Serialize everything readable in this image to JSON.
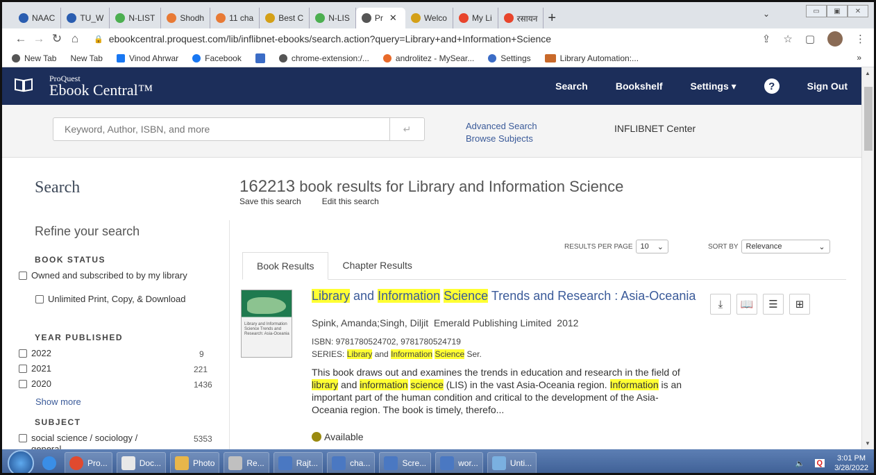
{
  "browser": {
    "tabs": [
      {
        "label": "NAAC",
        "color": "#2a5db0"
      },
      {
        "label": "TU_W",
        "color": "#2a5db0"
      },
      {
        "label": "N-LIST",
        "color": "#4caf50"
      },
      {
        "label": "Shodh",
        "color": "#e87a35"
      },
      {
        "label": "11 cha",
        "color": "#e87a35"
      },
      {
        "label": "Best C",
        "color": "#d4a017"
      },
      {
        "label": "N-LIS",
        "color": "#4caf50"
      },
      {
        "label": "Pr",
        "color": "#555555",
        "active": true
      },
      {
        "label": "Welco",
        "color": "#d4a017"
      },
      {
        "label": "My Li",
        "color": "#e8452c"
      },
      {
        "label": "रसायन",
        "color": "#e8452c"
      }
    ],
    "newtab": "+",
    "url": "ebookcentral.proquest.com/lib/inflibnet-ebooks/search.action?query=Library+and+Information+Science",
    "bookmarks": [
      {
        "label": "New Tab",
        "icon": "globe-icon"
      },
      {
        "label": "New Tab",
        "icon": ""
      },
      {
        "label": "Vinod Ahrwar",
        "icon": "facebook-icon"
      },
      {
        "label": "Facebook",
        "icon": "facebook-icon"
      },
      {
        "label": "",
        "icon": "search-icon"
      },
      {
        "label": "chrome-extension:/...",
        "icon": "globe-icon"
      },
      {
        "label": "androlitez - MySear...",
        "icon": "app-icon"
      },
      {
        "label": "Settings",
        "icon": "gear-icon"
      },
      {
        "label": "Library Automation:...",
        "icon": "folder-icon"
      }
    ],
    "bookmarks_more": "»"
  },
  "header": {
    "brand_small": "ProQuest",
    "brand_big": "Ebook Central™",
    "nav": [
      "Search",
      "Bookshelf",
      "Settings ▾",
      "Sign Out"
    ]
  },
  "search": {
    "placeholder": "Keyword, Author, ISBN, and more",
    "advanced": "Advanced Search",
    "browse": "Browse Subjects",
    "institution": "INFLIBNET Center"
  },
  "sidebar": {
    "title": "Search",
    "refine": "Refine your search",
    "book_status": "BOOK STATUS",
    "owned": "Owned and subscribed to by my library",
    "unlimited": "Unlimited Print, Copy, & Download",
    "year_published": "YEAR PUBLISHED",
    "years": [
      {
        "label": "2022",
        "count": "9"
      },
      {
        "label": "2021",
        "count": "221"
      },
      {
        "label": "2020",
        "count": "1436"
      }
    ],
    "show_more": "Show more",
    "subject": "SUBJECT",
    "subjects": [
      {
        "label": "social science / sociology / general",
        "count": "5353"
      }
    ]
  },
  "results": {
    "count": "162213",
    "heading_rest": "book results for Library and Information Science",
    "save": "Save this search",
    "edit": "Edit this search",
    "rpp_label": "RESULTS PER PAGE",
    "rpp_value": "10",
    "sort_label": "SORT BY",
    "sort_value": "Relevance",
    "tab_books": "Book Results",
    "tab_chapters": "Chapter Results"
  },
  "item": {
    "title_w1": "Library",
    "title_and": " and ",
    "title_w2": "Information",
    "title_w3": "Science",
    "title_rest": " Trends and Research : Asia-Oceania",
    "authors": "Spink, Amanda;Singh, Diljit  Emerald Publishing Limited  2012",
    "isbn": "ISBN: 9781780524702, 9781780524719",
    "series_label": "SERIES: ",
    "series_w1": "Library",
    "series_and": " and ",
    "series_w2": "Information",
    "series_w3": "Science",
    "series_rest": " Ser.",
    "desc_1": "This book draws out and examines the trends in education and research in the field of ",
    "desc_hl1": "library",
    "desc_2": " and ",
    "desc_hl2": "information",
    "desc_hl3": "science",
    "desc_3": " (LIS) in the vast Asia-Oceania region. ",
    "desc_hl4": "Information",
    "desc_4": " is an important part of the human condition and critical to the development of the Asia-Oceania region. The book is timely, therefo...",
    "availability": "Available",
    "cover_text": "Library and Information Science Trends and Research: Asia-Oceania"
  },
  "taskbar": {
    "items": [
      {
        "label": "Pro...",
        "color": "#e04a2f"
      },
      {
        "label": "Doc...",
        "color": "#e8e8e8"
      },
      {
        "label": "Photo",
        "color": "#e8b64a"
      },
      {
        "label": "Re...",
        "color": "#c0c0c0"
      },
      {
        "label": "Rajt...",
        "color": "#4a78c2"
      },
      {
        "label": "cha...",
        "color": "#4a78c2"
      },
      {
        "label": "Scre...",
        "color": "#4a78c2"
      },
      {
        "label": "wor...",
        "color": "#4a78c2"
      },
      {
        "label": "Unti...",
        "color": "#7ab0e0"
      }
    ],
    "time": "3:01 PM",
    "date": "3/28/2022"
  }
}
